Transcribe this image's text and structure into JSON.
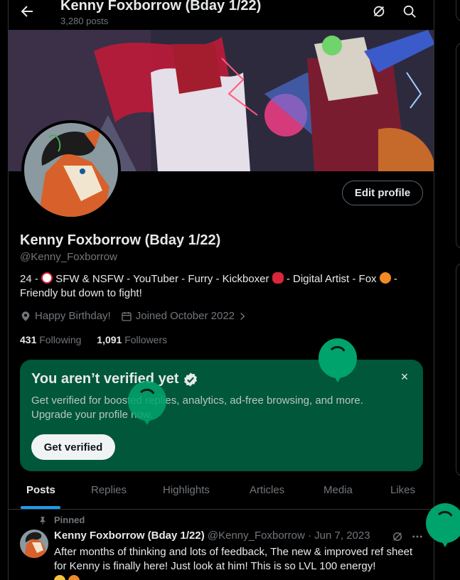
{
  "header": {
    "title": "Kenny Foxborrow (Bday 1/22)",
    "post_count": "3,280 posts"
  },
  "profile": {
    "edit_label": "Edit profile",
    "display_name": "Kenny Foxborrow (Bday 1/22)",
    "handle": "@Kenny_Foxborrow",
    "bio_part1": "24 - ",
    "bio_part2": " SFW & NSFW - YouTuber - Furry - Kickboxer ",
    "bio_part3": " - Digital Artist - Fox ",
    "bio_part4": " - Friendly but down to fight!",
    "location": "Happy Birthday!",
    "joined": "Joined October 2022",
    "following_count": "431",
    "following_label": "Following",
    "followers_count": "1,091",
    "followers_label": "Followers"
  },
  "verify_card": {
    "title": "You aren’t verified yet",
    "text": "Get verified for boosted replies, analytics, ad-free browsing, and more. Upgrade your profile now.",
    "button": "Get verified",
    "close": "×"
  },
  "tabs": [
    "Posts",
    "Replies",
    "Highlights",
    "Articles",
    "Media",
    "Likes"
  ],
  "active_tab": "Posts",
  "pinned_post": {
    "pinned_label": "Pinned",
    "author": "Kenny Foxborrow (Bday 1/22)",
    "meta": "@Kenny_Foxborrow · Jun 7, 2023",
    "text": "After months of thinking and lots of feedback, The new & improved ref sheet for Kenny is finally here! Just look at him! This is so LVL 100 energy!"
  },
  "colors": {
    "accent": "#1d9bf0",
    "verify_bg": "#00573a",
    "balloon": "#00a36c"
  },
  "icons": [
    "back-arrow-icon",
    "grok-icon",
    "search-icon",
    "location-icon",
    "calendar-icon",
    "verified-badge-icon",
    "close-icon",
    "pin-icon",
    "more-icon"
  ]
}
